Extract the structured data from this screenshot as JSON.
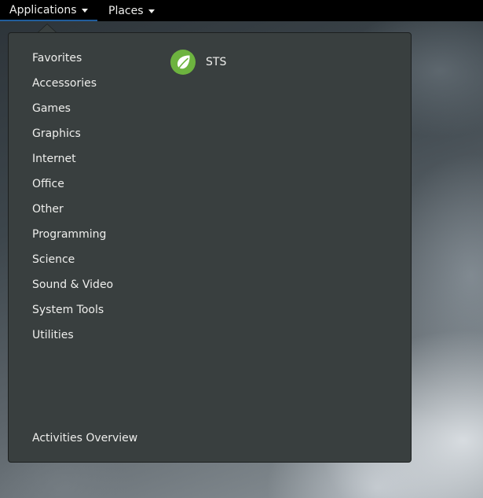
{
  "topbar": {
    "applications_label": "Applications",
    "places_label": "Places"
  },
  "menu": {
    "categories": [
      "Favorites",
      "Accessories",
      "Games",
      "Graphics",
      "Internet",
      "Office",
      "Other",
      "Programming",
      "Science",
      "Sound & Video",
      "System Tools",
      "Utilities"
    ],
    "apps": [
      {
        "label": "STS",
        "icon": "spring-leaf-icon"
      }
    ],
    "activities_label": "Activities Overview"
  },
  "colors": {
    "topbar_bg": "#000000",
    "menu_bg": "#393f3f",
    "text": "#eeeeec",
    "accent_underline": "#215d9c",
    "app_icon_green": "#6db33f"
  }
}
